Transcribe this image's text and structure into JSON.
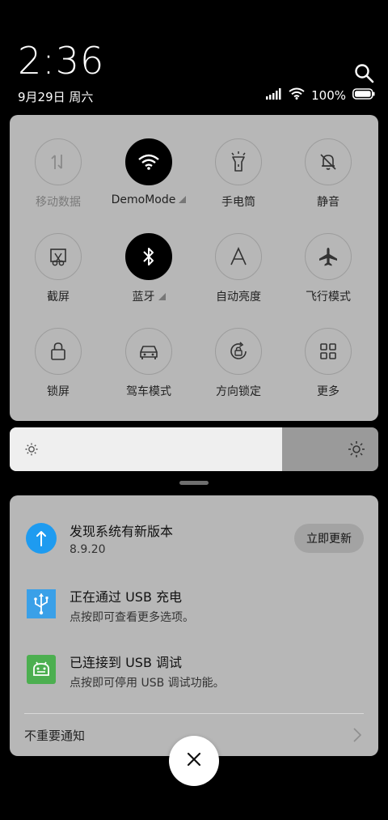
{
  "status_bar": {
    "time": "2:36",
    "date": "9月29日 周六",
    "battery": "100%"
  },
  "quick_settings": [
    {
      "label": "移动数据",
      "icon": "mobile-data-icon",
      "active": false,
      "dim": true
    },
    {
      "label": "DemoMode",
      "icon": "wifi-icon",
      "active": true,
      "expandable": true
    },
    {
      "label": "手电筒",
      "icon": "flashlight-icon",
      "active": false
    },
    {
      "label": "静音",
      "icon": "mute-bell-icon",
      "active": false
    },
    {
      "label": "截屏",
      "icon": "screenshot-icon",
      "active": false
    },
    {
      "label": "蓝牙",
      "icon": "bluetooth-icon",
      "active": true,
      "expandable": true
    },
    {
      "label": "自动亮度",
      "icon": "auto-brightness-icon",
      "active": false
    },
    {
      "label": "飞行模式",
      "icon": "airplane-icon",
      "active": false
    },
    {
      "label": "锁屏",
      "icon": "lock-icon",
      "active": false
    },
    {
      "label": "驾车模式",
      "icon": "car-icon",
      "active": false
    },
    {
      "label": "方向锁定",
      "icon": "rotation-lock-icon",
      "active": false
    },
    {
      "label": "更多",
      "icon": "grid-icon",
      "active": false
    }
  ],
  "brightness": {
    "level": 0.74
  },
  "notifications": {
    "update": {
      "title": "发现系统有新版本",
      "subtitle": "8.9.20",
      "button": "立即更新",
      "icon_color": "#1e9bf0"
    },
    "usb_charge": {
      "title": "正在通过 USB 充电",
      "subtitle": "点按即可查看更多选项。",
      "icon_color": "#3aa0e8"
    },
    "usb_debug": {
      "title": "已连接到 USB 调试",
      "subtitle": "点按即可停用 USB 调试功能。",
      "icon_color": "#4caf50"
    },
    "unimportant": "不重要通知"
  }
}
